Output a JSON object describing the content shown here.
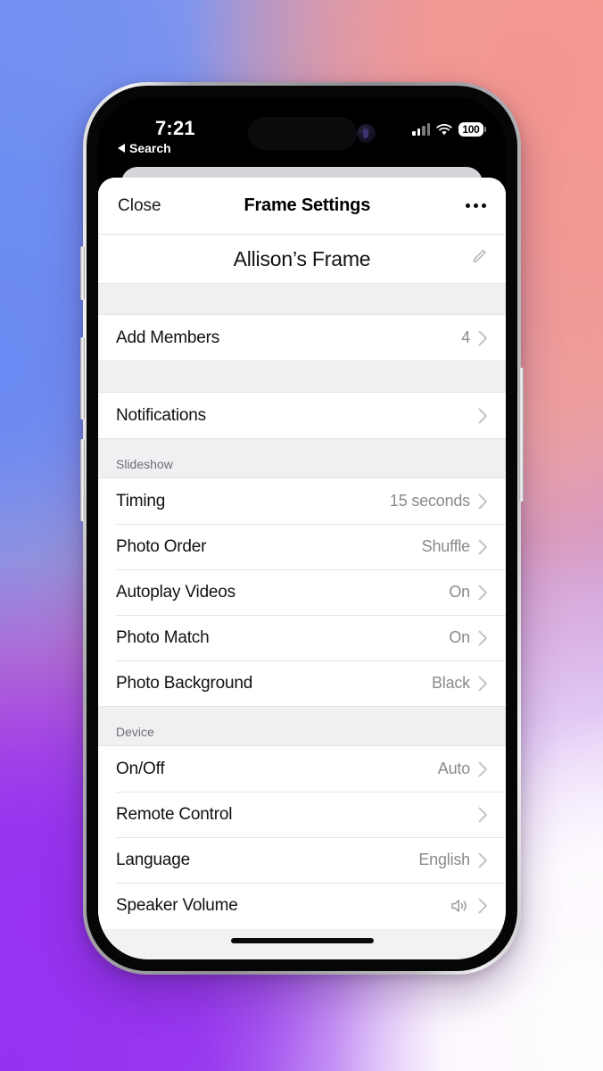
{
  "wallpaper": {
    "colors": [
      "#6f8ff2",
      "#f59a92",
      "#9333ef",
      "#fdfaff"
    ]
  },
  "status_bar": {
    "time": "7:21",
    "back_label": "Search",
    "back_icon": "triangle-left-icon",
    "signal_icon": "cellular-bars-icon",
    "wifi_icon": "wifi-icon",
    "battery_percent": "100",
    "dynamic_island": "dynamic-island",
    "camera": "front-camera-dot"
  },
  "nav": {
    "close_label": "Close",
    "title": "Frame Settings",
    "more_icon": "ellipsis-icon"
  },
  "frame": {
    "name": "Allison’s Frame",
    "edit_icon": "pencil-icon"
  },
  "list": [
    {
      "kind": "gap"
    },
    {
      "kind": "rows",
      "rows": [
        {
          "label": "Add Members",
          "value": "4",
          "icon": "",
          "chevron": true
        }
      ]
    },
    {
      "kind": "gap"
    },
    {
      "kind": "rows",
      "rows": [
        {
          "label": "Notifications",
          "value": "",
          "icon": "",
          "chevron": true
        }
      ]
    },
    {
      "kind": "section",
      "title": "Slideshow",
      "rows": [
        {
          "label": "Timing",
          "value": "15 seconds",
          "icon": "",
          "chevron": true
        },
        {
          "label": "Photo Order",
          "value": "Shuffle",
          "icon": "",
          "chevron": true
        },
        {
          "label": "Autoplay Videos",
          "value": "On",
          "icon": "",
          "chevron": true
        },
        {
          "label": "Photo Match",
          "value": "On",
          "icon": "",
          "chevron": true
        },
        {
          "label": "Photo Background",
          "value": "Black",
          "icon": "",
          "chevron": true
        }
      ]
    },
    {
      "kind": "section",
      "title": "Device",
      "rows": [
        {
          "label": "On/Off",
          "value": "Auto",
          "icon": "",
          "chevron": true
        },
        {
          "label": "Remote Control",
          "value": "",
          "icon": "",
          "chevron": true
        },
        {
          "label": "Language",
          "value": "English",
          "icon": "",
          "chevron": true
        },
        {
          "label": "Speaker Volume",
          "value": "",
          "icon": "speaker-wave-icon",
          "chevron": true
        }
      ]
    }
  ],
  "home_indicator": "home-indicator"
}
